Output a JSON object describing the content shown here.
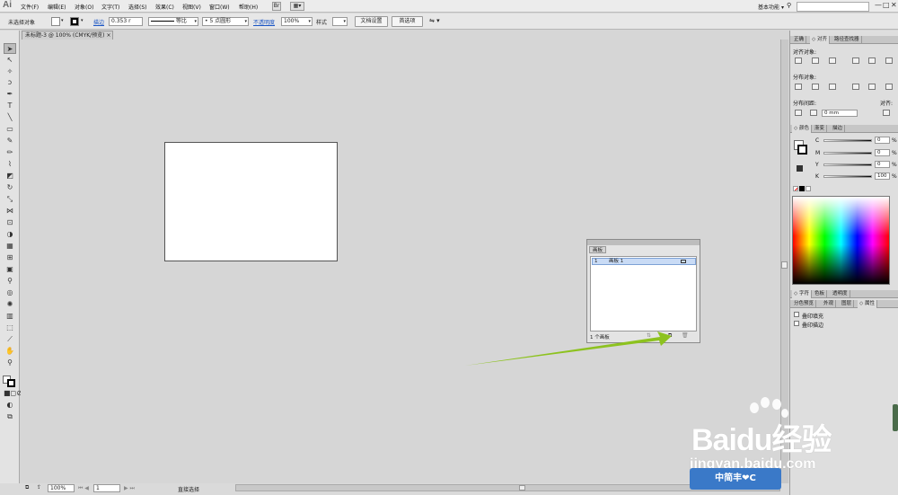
{
  "app": {
    "logo": "Ai",
    "workspace": "基本功能",
    "workspace_arrow": "▾",
    "window_controls": [
      "—",
      "□",
      "✕"
    ]
  },
  "menu": [
    "文件(F)",
    "编辑(E)",
    "对象(O)",
    "文字(T)",
    "选择(S)",
    "效果(C)",
    "视图(V)",
    "窗口(W)",
    "帮助(H)"
  ],
  "menu_icons": [
    "Br",
    "▦▾"
  ],
  "controlbar": {
    "selection": "未选择对象",
    "stroke_label": "描边",
    "stroke_value": "0.353 r",
    "profile": "等比",
    "brush": "5 点圆形",
    "opacity_label": "不透明度",
    "opacity_value": "100%",
    "style_label": "样式",
    "doc_setup": "文档设置",
    "prefs": "首选项"
  },
  "document": {
    "tab": "未标题-3 @ 100% (CMYK/预览)"
  },
  "align_panel": {
    "tabs": [
      "正确",
      "◇ 对齐",
      "路径查找器"
    ],
    "align_objects": "对齐对象:",
    "distribute_objects": "分布对象:",
    "distribute_spacing": "分布间距:",
    "spacing_value": "0 mm",
    "align_to": "对齐:"
  },
  "color_panel": {
    "tabs": [
      "◇ 颜色",
      "渐变",
      "描边"
    ],
    "channels": [
      {
        "label": "C",
        "value": "0",
        "unit": "%"
      },
      {
        "label": "M",
        "value": "0",
        "unit": "%"
      },
      {
        "label": "Y",
        "value": "0",
        "unit": "%"
      },
      {
        "label": "K",
        "value": "100",
        "unit": "%"
      }
    ]
  },
  "char_panel": {
    "tabs": [
      "◇ 字符",
      "色板",
      "透明度"
    ]
  },
  "attr_panel": {
    "tabs": [
      "分色预览",
      "外观",
      "图层",
      "◇ 属性"
    ],
    "overprint_fill": "叠印填充",
    "overprint_stroke": "叠印描边"
  },
  "artboards_panel": {
    "tab": "画板",
    "row_index": "1",
    "row_name": "画板 1",
    "footer": "1 个画板"
  },
  "statusbar": {
    "zoom": "100%",
    "page": "1",
    "tool": "直接选择"
  },
  "watermark": {
    "brand": "Baidu经验",
    "url": "jingyan.baidu.com",
    "badge": "中简丰❤C"
  },
  "colors": {
    "arrow": "#8dc21f",
    "selection": "#c9dbf5",
    "badge": "#3a79c8"
  }
}
